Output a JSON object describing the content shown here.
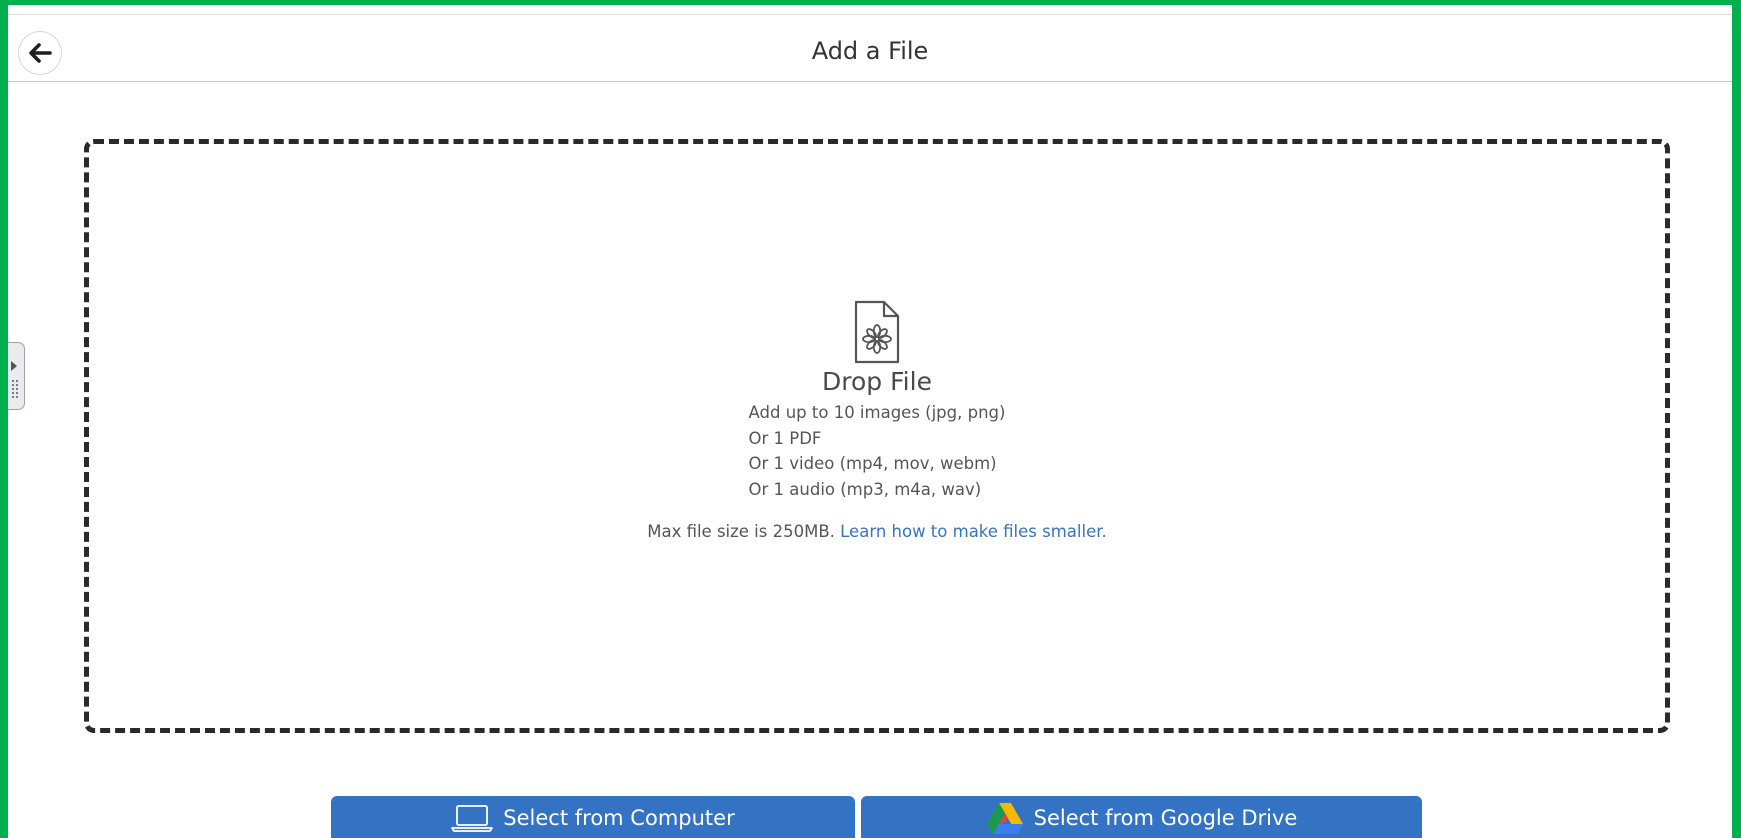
{
  "header": {
    "title": "Add a File",
    "back_icon": "arrow-left-icon"
  },
  "dropzone": {
    "icon": "file-flower-icon",
    "title": "Drop File",
    "lines": [
      "Add up to 10 images (jpg, png)",
      "Or 1 PDF",
      "Or 1 video (mp4, mov, webm)",
      "Or 1 audio (mp3, m4a, wav)"
    ],
    "max_size_text": "Max file size is 250MB.",
    "learn_link": "Learn how to make files smaller."
  },
  "buttons": {
    "computer_label": "Select from Computer",
    "computer_icon": "laptop-icon",
    "drive_label": "Select from Google Drive",
    "drive_icon": "google-drive-icon"
  },
  "colors": {
    "accent": "#3472c4",
    "link": "#3b72bf",
    "frame_border": "#00b04f"
  }
}
